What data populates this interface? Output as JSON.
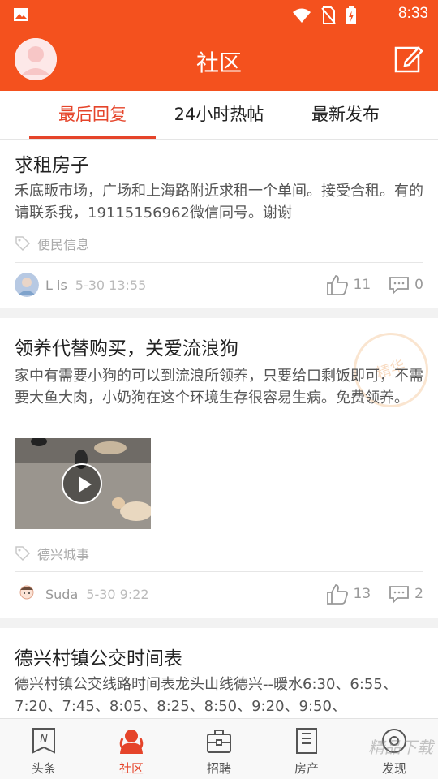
{
  "status_bar": {
    "time": "8:33"
  },
  "header": {
    "title": "社区"
  },
  "tabs": [
    {
      "label": "最后回复",
      "active": true
    },
    {
      "label": "24小时热帖",
      "active": false
    },
    {
      "label": "最新发布",
      "active": false
    }
  ],
  "posts": [
    {
      "title": "求租房子",
      "body": "禾底畈市场，广场和上海路附近求租一个单间。接受合租。有的请联系我，19115156962微信同号。谢谢",
      "tag": "便民信息",
      "author": "L is",
      "time": "5-30 13:55",
      "likes": "11",
      "comments": "0"
    },
    {
      "title": "领养代替购买，关爱流浪狗",
      "body": "家中有需要小狗的可以到流浪所领养，只要给口剩饭即可，不需要大鱼大肉，小奶狗在这个环境生存很容易生病。免费领养。",
      "tag": "德兴城事",
      "author": "Suda",
      "time": "5-30 9:22",
      "likes": "13",
      "comments": "2",
      "stamp": "精华"
    },
    {
      "title": "德兴村镇公交时间表",
      "body": "德兴村镇公交线路时间表龙头山线德兴--暖水6:30、6:55、7:20、7:45、8:05、8:25、8:50、9:20、9:50、"
    }
  ],
  "bottom_nav": [
    {
      "label": "头条",
      "icon": "news-icon",
      "active": false
    },
    {
      "label": "社区",
      "icon": "community-icon",
      "active": true
    },
    {
      "label": "招聘",
      "icon": "briefcase-icon",
      "active": false
    },
    {
      "label": "房产",
      "icon": "building-icon",
      "active": false
    },
    {
      "label": "发现",
      "icon": "compass-icon",
      "active": false
    }
  ],
  "watermark": "精品下载",
  "colors": {
    "brand": "#f4511e",
    "accent": "#e5442a"
  }
}
